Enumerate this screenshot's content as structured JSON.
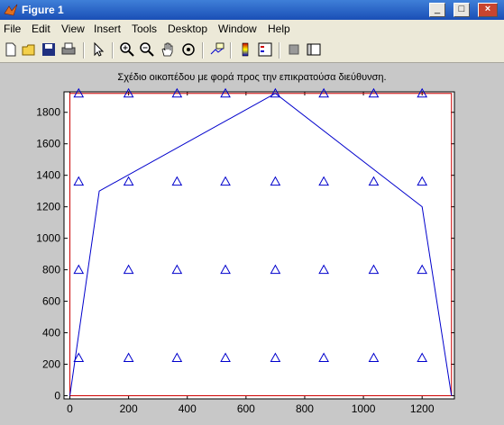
{
  "window": {
    "title": "Figure 1"
  },
  "titlebar_buttons": [
    "_",
    "□",
    "×"
  ],
  "menu": [
    "File",
    "Edit",
    "View",
    "Insert",
    "Tools",
    "Desktop",
    "Window",
    "Help"
  ],
  "toolbar": {
    "icons": [
      "new-icon",
      "open-icon",
      "save-icon",
      "print-icon",
      "pointer-icon",
      "zoom-in-icon",
      "zoom-out-icon",
      "pan-icon",
      "rotate-icon",
      "data-cursor-icon",
      "colorbar-icon",
      "legend-icon",
      "hide-plot-tools-icon",
      "show-plot-tools-icon"
    ]
  },
  "plot_title": "Σχέδιο οικοπέδου με φορά προς την επικρατούσα διεύθυνση.",
  "colors": {
    "boundary": "#cc0000",
    "polygon": "#0000cc",
    "markers": "#0000cc",
    "axes_bg": "#ffffff",
    "figure_bg": "#c8c8c8"
  },
  "chart_data": {
    "type": "line",
    "title": "Σχέδιο οικοπέδου με φορά προς την επικρατούσα διεύθυνση.",
    "xlabel": "",
    "ylabel": "",
    "xlim": [
      -20,
      1310
    ],
    "ylim": [
      -20,
      1930
    ],
    "xticks": [
      0,
      200,
      400,
      600,
      800,
      1000,
      1200
    ],
    "yticks": [
      0,
      200,
      400,
      600,
      800,
      1000,
      1200,
      1400,
      1600,
      1800
    ],
    "grid": false,
    "series": [
      {
        "kind": "boundary-rectangle",
        "x": [
          0,
          1300,
          1300,
          0,
          0
        ],
        "y": [
          0,
          0,
          1920,
          1920,
          0
        ]
      },
      {
        "kind": "polygon-line",
        "x": [
          0,
          100,
          700,
          1200,
          1300
        ],
        "y": [
          0,
          1300,
          1920,
          1200,
          0
        ]
      },
      {
        "kind": "triangle-markers",
        "x_positions": [
          30,
          200,
          365,
          530,
          700,
          865,
          1035,
          1200
        ],
        "y_positions": [
          240,
          800,
          1360,
          1920
        ]
      }
    ]
  }
}
